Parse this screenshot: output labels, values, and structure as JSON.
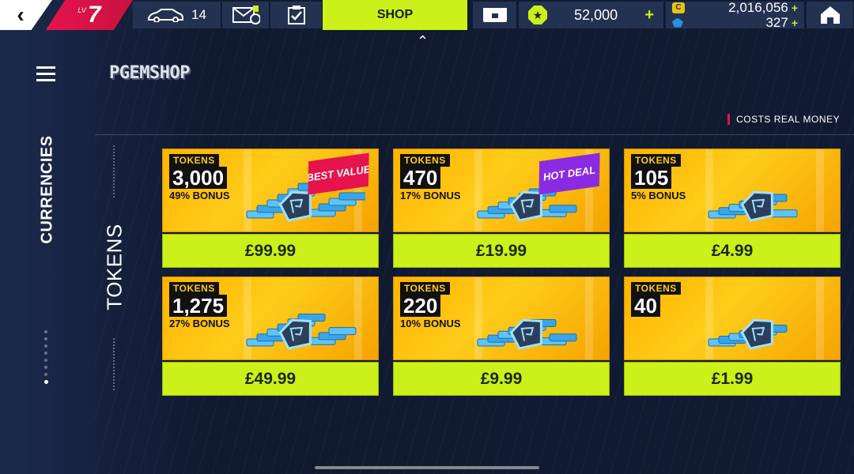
{
  "topbar": {
    "back_icon": "chevron-left-icon",
    "level_prefix": "LV",
    "level": "7",
    "cars_count": "14",
    "mail_badge": "!",
    "shop_label": "SHOP",
    "rank_value": "52,000",
    "credits": "2,016,056",
    "credits_symbol": "C",
    "tokens": "327",
    "plus": "+"
  },
  "shop": {
    "title": "PGEMSHOP",
    "costs_note": "COSTS REAL MONEY",
    "side_tab": "CURRENCIES",
    "section_label": "TOKENS"
  },
  "cards": [
    {
      "tag": "TOKENS",
      "amount": "3,000",
      "bonus": "49% BONUS",
      "price": "£99.99",
      "ribbon": "BEST VALUE",
      "ribbon_color": "#e6134d"
    },
    {
      "tag": "TOKENS",
      "amount": "470",
      "bonus": "17% BONUS",
      "price": "£19.99",
      "ribbon": "HOT DEAL",
      "ribbon_color": "#8a2be2"
    },
    {
      "tag": "TOKENS",
      "amount": "105",
      "bonus": "5% BONUS",
      "price": "£4.99",
      "ribbon": "",
      "ribbon_color": ""
    },
    {
      "tag": "TOKENS",
      "amount": "1,275",
      "bonus": "27% BONUS",
      "price": "£49.99",
      "ribbon": "",
      "ribbon_color": ""
    },
    {
      "tag": "TOKENS",
      "amount": "220",
      "bonus": "10% BONUS",
      "price": "£9.99",
      "ribbon": "",
      "ribbon_color": ""
    },
    {
      "tag": "TOKENS",
      "amount": "40",
      "bonus": "",
      "price": "£1.99",
      "ribbon": "",
      "ribbon_color": ""
    }
  ],
  "colors": {
    "accent": "#ccf01a",
    "level_red": "#e6134d",
    "card_yellow": "#ffc107",
    "bg_navy": "#0f1a30"
  }
}
